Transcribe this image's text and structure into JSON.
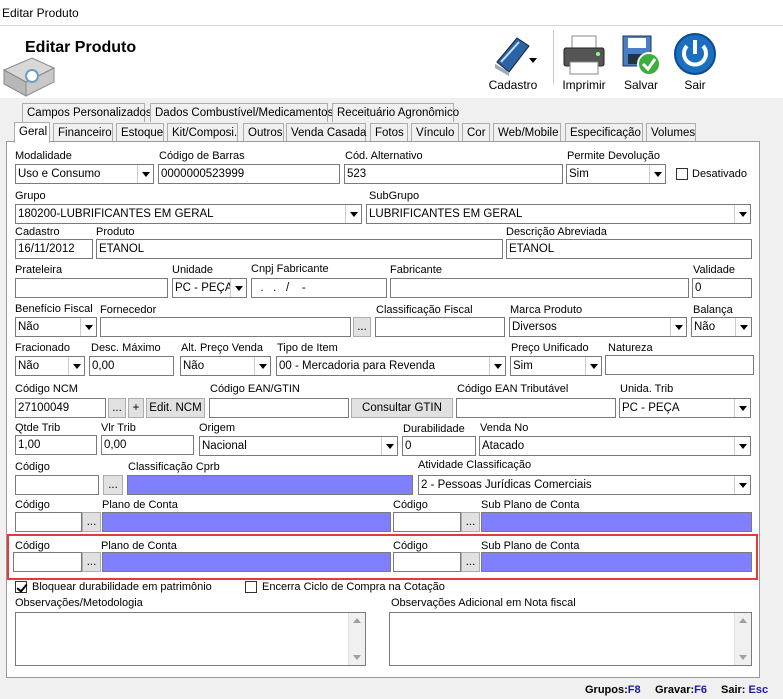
{
  "window": {
    "title": "Editar Produto"
  },
  "header": {
    "title": "Editar Produto"
  },
  "toolbar": {
    "cadastro": "Cadastro",
    "imprimir": "Imprimir",
    "salvar": "Salvar",
    "sair": "Sair"
  },
  "tabs_row1": [
    "Campos Personalizados",
    "Dados Combustível/Medicamentos",
    "Receituário Agronômico"
  ],
  "tabs_row2": [
    "Geral",
    "Financeiro",
    "Estoque",
    "Kit/Composi.",
    "Outros",
    "Venda Casada",
    "Fotos",
    "Vínculo",
    "Cor",
    "Web/Mobile",
    "Especificação",
    "Volumes"
  ],
  "form": {
    "modalidade": {
      "label": "Modalidade",
      "value": "Uso e Consumo"
    },
    "codigo_barras": {
      "label": "Código de Barras",
      "value": "0000000523999"
    },
    "cod_alternativo": {
      "label": "Cód. Alternativo",
      "value": "523"
    },
    "permite_devolucao": {
      "label": "Permite Devolução",
      "value": "Sim"
    },
    "desativado": {
      "label": "Desativado"
    },
    "grupo": {
      "label": "Grupo",
      "value": "180200-LUBRIFICANTES EM GERAL"
    },
    "subgrupo": {
      "label": "SubGrupo",
      "value": "LUBRIFICANTES EM GERAL"
    },
    "cadastro": {
      "label": "Cadastro",
      "value": "16/11/2012"
    },
    "produto": {
      "label": "Produto",
      "value": "ETANOL"
    },
    "descricao_abreviada": {
      "label": "Descrição Abreviada",
      "value": "ETANOL"
    },
    "prateleira": {
      "label": "Prateleira",
      "value": ""
    },
    "unidade": {
      "label": "Unidade",
      "value": "PC - PEÇA"
    },
    "cnpj_fabricante": {
      "label": "Cnpj Fabricante",
      "value": "  .   .   /    -  "
    },
    "fabricante": {
      "label": "Fabricante",
      "value": ""
    },
    "validade": {
      "label": "Validade",
      "value": "0"
    },
    "beneficio_fiscal": {
      "label": "Benefício Fiscal",
      "value": "Não"
    },
    "fornecedor": {
      "label": "Fornecedor",
      "value": ""
    },
    "classificacao_fiscal": {
      "label": "Classificação Fiscal",
      "value": ""
    },
    "marca_produto": {
      "label": "Marca Produto",
      "value": "Diversos"
    },
    "balanca": {
      "label": "Balança",
      "value": "Não"
    },
    "fracionado": {
      "label": "Fracionado",
      "value": "Não"
    },
    "desc_maximo": {
      "label": "Desc. Máximo",
      "value": "0,00"
    },
    "alt_preco_venda": {
      "label": "Alt. Preço Venda",
      "value": "Não"
    },
    "tipo_item": {
      "label": "Tipo de Item",
      "value": "00 - Mercadoria para Revenda"
    },
    "preco_unificado": {
      "label": "Preço Unificado",
      "value": "Sim"
    },
    "natureza": {
      "label": "Natureza",
      "value": ""
    },
    "codigo_ncm": {
      "label": "Código NCM",
      "value": "27100049"
    },
    "edit_ncm": "Edit. NCM",
    "codigo_ean_gtin": {
      "label": "Código EAN/GTIN",
      "value": ""
    },
    "consultar_gtin": "Consultar GTIN",
    "codigo_ean_tributavel": {
      "label": "Código EAN Tributável",
      "value": ""
    },
    "unida_trib": {
      "label": "Unida. Trib",
      "value": "PC - PEÇA"
    },
    "qtde_trib": {
      "label": "Qtde Trib",
      "value": "1,00"
    },
    "vlr_trib": {
      "label": "Vlr Trib",
      "value": "0,00"
    },
    "origem": {
      "label": "Origem",
      "value": "Nacional"
    },
    "durabilidade": {
      "label": "Durabilidade",
      "value": "0"
    },
    "venda_no": {
      "label": "Venda No",
      "value": "Atacado"
    },
    "codigo_cprb": {
      "label": "Código",
      "value": ""
    },
    "classificacao_cprb": {
      "label": "Classificação Cprb",
      "value": ""
    },
    "atividade_classificacao": {
      "label": "Atividade Classificação",
      "value": "2 - Pessoas Jurídicas Comerciais"
    },
    "conta_row1": {
      "codigo_label": "Código",
      "plano_label": "Plano de Conta",
      "codigo2_label": "Código",
      "sub_label": "Sub Plano de Conta"
    },
    "conta_row2": {
      "codigo_label": "Código",
      "plano_label": "Plano de Conta",
      "codigo2_label": "Código",
      "sub_label": "Sub Plano de Conta"
    },
    "bloquear_durabilidade": "Bloquear durabilidade em patrimônio",
    "encerra_ciclo": "Encerra Ciclo de Compra na Cotação",
    "observacoes": {
      "label": "Observações/Metodologia"
    },
    "observacoes_nf": {
      "label": "Observações Adicional em Nota fiscal"
    },
    "ellipsis": "...",
    "plus": "+"
  },
  "status": {
    "grupos_label": "Grupos:",
    "grupos_key": "F8",
    "gravar_label": "Gravar:",
    "gravar_key": "F6",
    "sair_label": "Sair:",
    "sair_key": "Esc"
  },
  "colors": {
    "purple_field": "#8080ff",
    "highlight": "#e03c3c",
    "accent": "#1a6fc2"
  }
}
